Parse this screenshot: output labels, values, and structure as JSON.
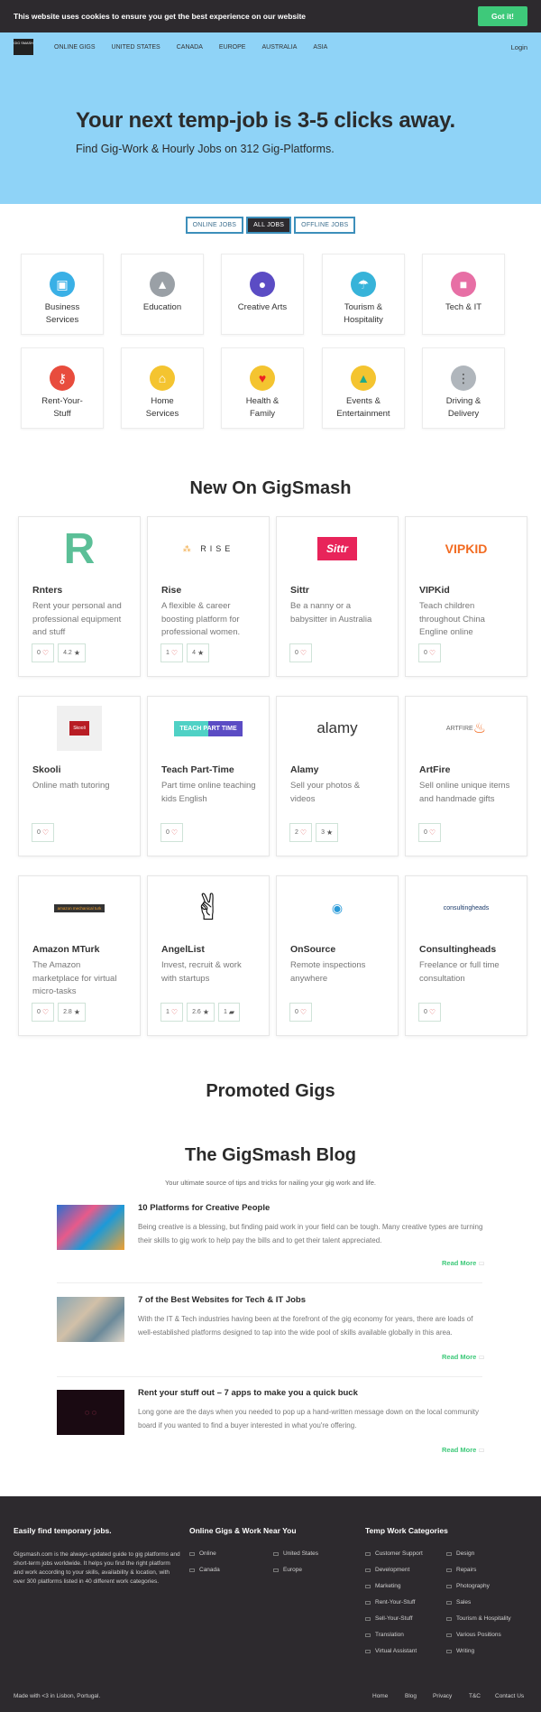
{
  "cookie": {
    "text": "This website uses cookies to ensure you get the best experience on our website",
    "button": "Got it!"
  },
  "nav": {
    "logo": "GIG SMASH",
    "links": [
      "ONLINE GIGS",
      "UNITED STATES",
      "CANADA",
      "EUROPE",
      "AUSTRALIA",
      "ASIA"
    ],
    "login": "Login"
  },
  "hero": {
    "title": "Your next temp-job is 3-5 clicks away.",
    "subtitle": "Find Gig-Work & Hourly Jobs on 312 Gig-Platforms."
  },
  "filters": [
    "ONLINE JOBS",
    "ALL JOBS",
    "OFFLINE JOBS"
  ],
  "categories": [
    {
      "l1": "Business",
      "l2": "Services",
      "icon": "briefcase-icon",
      "color": "#3ab0e6"
    },
    {
      "l1": "Education",
      "l2": "",
      "icon": "graduation-cap-icon",
      "color": "#9aa0a6"
    },
    {
      "l1": "Creative Arts",
      "l2": "",
      "icon": "lightbulb-icon",
      "color": "#5b4cc4"
    },
    {
      "l1": "Tourism &",
      "l2": "Hospitality",
      "icon": "beach-icon",
      "color": "#37b3d9"
    },
    {
      "l1": "Tech & IT",
      "l2": "",
      "icon": "chip-icon",
      "color": "#e76fa5"
    },
    {
      "l1": "Rent-Your-",
      "l2": "Stuff",
      "icon": "key-icon",
      "color": "#e84c3d"
    },
    {
      "l1": "Home",
      "l2": "Services",
      "icon": "house-icon",
      "color": "#f4c430"
    },
    {
      "l1": "Health &",
      "l2": "Family",
      "icon": "heart-icon",
      "color": "#f4c430"
    },
    {
      "l1": "Events &",
      "l2": "Entertainment",
      "icon": "tent-icon",
      "color": "#f4c430"
    },
    {
      "l1": "Driving &",
      "l2": "Delivery",
      "icon": "traffic-light-icon",
      "color": "#b0b6bc"
    }
  ],
  "new_title": "New On GigSmash",
  "platforms": [
    {
      "name": "Rnters",
      "desc": "Rent your personal and professional equipment and stuff",
      "stats": [
        "0",
        "4.2"
      ],
      "logo": "R"
    },
    {
      "name": "Rise",
      "desc": "A flexible & career boosting platform for professional women.",
      "stats": [
        "1",
        "4"
      ],
      "logo": "RISE"
    },
    {
      "name": "Sittr",
      "desc": "Be a nanny or a babysitter in Australia",
      "stats": [
        "0"
      ],
      "logo": "Sittr"
    },
    {
      "name": "VIPKid",
      "desc": "Teach children throughout China Engline online",
      "stats": [
        "0"
      ],
      "logo": "VIPKID"
    },
    {
      "name": "Skooli",
      "desc": "Online math tutoring",
      "stats": [
        "0"
      ],
      "logo": "Skooli"
    },
    {
      "name": "Teach Part-Time",
      "desc": "Part time online teaching kids English",
      "stats": [
        "0"
      ],
      "logo": "TEACH PART TIME"
    },
    {
      "name": "Alamy",
      "desc": "Sell your photos & videos",
      "stats": [
        "2",
        "3"
      ],
      "logo": "alamy"
    },
    {
      "name": "ArtFire",
      "desc": "Sell online unique items and handmade gifts",
      "stats": [
        "0"
      ],
      "logo": "ARTFIRE"
    },
    {
      "name": "Amazon MTurk",
      "desc": "The Amazon marketplace for virtual micro-tasks",
      "stats": [
        "0",
        "2.8"
      ],
      "logo": "amazon mechanical turk"
    },
    {
      "name": "AngelList",
      "desc": "Invest, recruit & work with startups",
      "stats": [
        "1",
        "2.6",
        "1"
      ],
      "logo": "✌"
    },
    {
      "name": "OnSource",
      "desc": "Remote inspections anywhere",
      "stats": [
        "0"
      ],
      "logo": "◉"
    },
    {
      "name": "Consultingheads",
      "desc": "Freelance or full time consultation",
      "stats": [
        "0"
      ],
      "logo": "consultingheads"
    }
  ],
  "promoted_title": "Promoted Gigs",
  "blog": {
    "title": "The GigSmash Blog",
    "subtitle": "Your ultimate source of tips and tricks for nailing your gig work and life.",
    "read_more": "Read More",
    "posts": [
      {
        "title": "10 Platforms for Creative People",
        "text": "Being creative is a blessing, but finding paid work in your field can be tough. Many creative types are turning their skills to gig work to help pay the bills and to get their talent appreciated."
      },
      {
        "title": "7 of the Best Websites for Tech & IT Jobs",
        "text": "With the IT & Tech industries having been at the forefront of the gig economy for years, there are loads of well-established platforms designed to tap into the wide pool of skills available globally in this area."
      },
      {
        "title": "Rent your stuff out – 7 apps to make you a quick buck",
        "text": "Long gone are the days when you needed to pop up a hand-written message down on the local community board if you wanted to find a buyer interested in what you're offering."
      }
    ]
  },
  "footer": {
    "about_title": "Easily find temporary jobs.",
    "about_text": "Gigsmash.com is the always-updated guide to gig platforms and short-term jobs worldwide. It helps you find the right platform and work according to your skills, availability & location, with over 300 platforms listed in 40 different work categories.",
    "near_title": "Online Gigs & Work Near You",
    "near_links": [
      "Online",
      "United States",
      "Canada",
      "Europe"
    ],
    "cat_title": "Temp Work Categories",
    "cat_links": [
      "Customer Support",
      "Design",
      "Development",
      "Repairs",
      "Marketing",
      "Photography",
      "Rent-Your-Stuff",
      "Sales",
      "Sell-Your-Stuff",
      "Tourism & Hospitality",
      "Translation",
      "Various Positions",
      "Virtual Assistant",
      "Writing"
    ],
    "made": "Made with <3 in Lisbon, Portugal.",
    "bottom_links": [
      "Home",
      "Blog",
      "Privacy",
      "T&C",
      "Contact Us"
    ]
  }
}
